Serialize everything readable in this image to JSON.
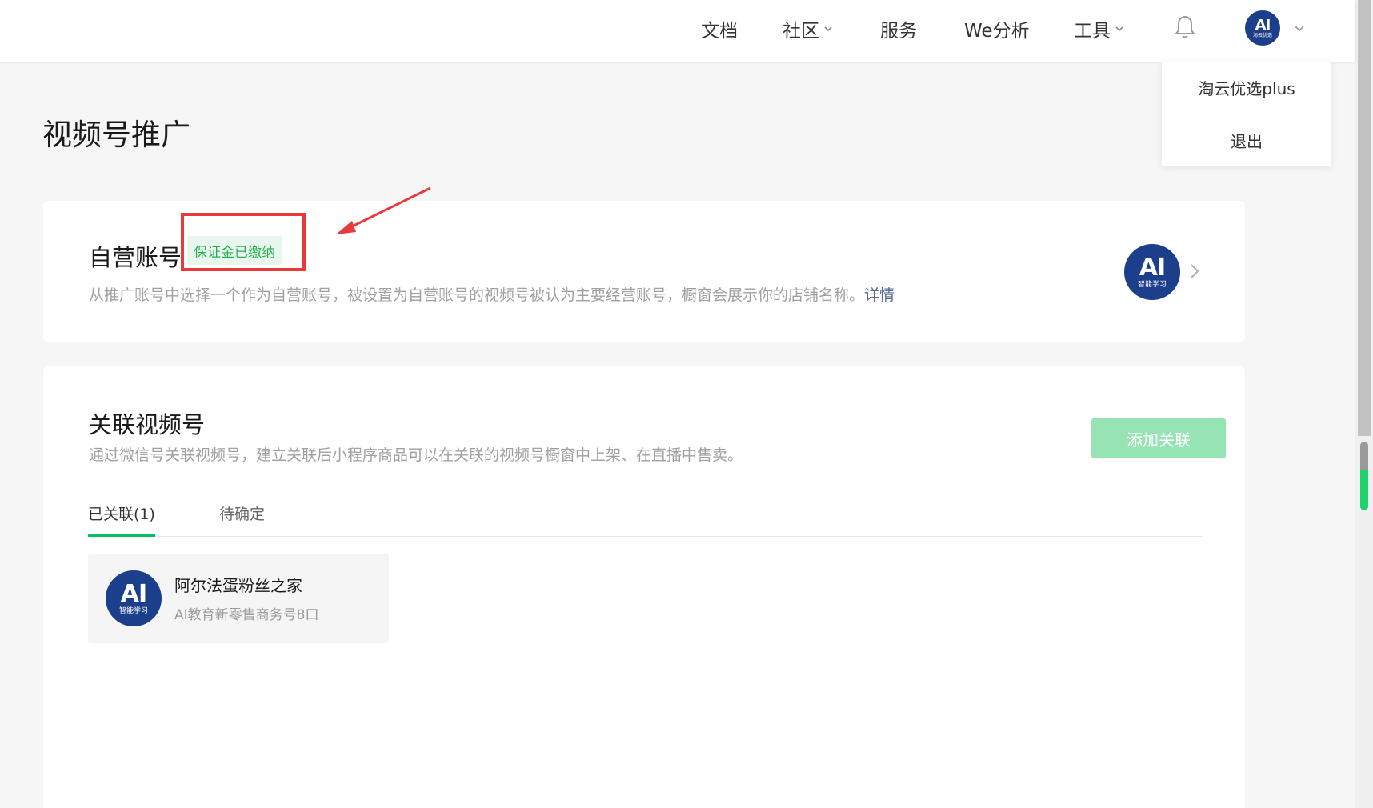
{
  "nav": {
    "items": [
      {
        "label": "文档",
        "has_dropdown": false
      },
      {
        "label": "社区",
        "has_dropdown": true
      },
      {
        "label": "服务",
        "has_dropdown": false
      },
      {
        "label": "We分析",
        "has_dropdown": false
      },
      {
        "label": "工具",
        "has_dropdown": true
      }
    ],
    "bell_icon": "bell-icon",
    "avatar_logo": {
      "text": "AI",
      "subtext": "淘云优选"
    }
  },
  "dropdown": {
    "items": [
      {
        "label": "淘云优选plus"
      },
      {
        "label": "退出"
      }
    ]
  },
  "page": {
    "title": "视频号推广"
  },
  "self_account": {
    "title": "自营账号",
    "badge": "保证金已缴纳",
    "description": "从推广账号中选择一个作为自营账号，被设置为自营账号的视频号被认为主要经营账号，橱窗会展示你的店铺名称。",
    "detail_link": "详情",
    "avatar_logo": {
      "text": "AI",
      "subtext": "智能学习"
    }
  },
  "linked": {
    "title": "关联视频号",
    "description": "通过微信号关联视频号，建立关联后小程序商品可以在关联的视频号橱窗中上架、在直播中售卖。",
    "add_button": "添加关联",
    "tabs": [
      {
        "label": "已关联(1)",
        "active": true
      },
      {
        "label": "待确定",
        "active": false
      }
    ],
    "items": [
      {
        "name": "阿尔法蛋粉丝之家",
        "sub": "AI教育新零售商务号8口",
        "avatar_logo": {
          "text": "AI",
          "subtext": "智能学习"
        }
      }
    ]
  },
  "colors": {
    "accent": "#07c160",
    "add_button_bg": "#96e3b3",
    "badge_text": "#23b14d",
    "badge_bg": "#e8f6ee",
    "annotation_red": "#e83a3d",
    "link": "#576b95",
    "logo_blue": "#1c3f8c"
  }
}
